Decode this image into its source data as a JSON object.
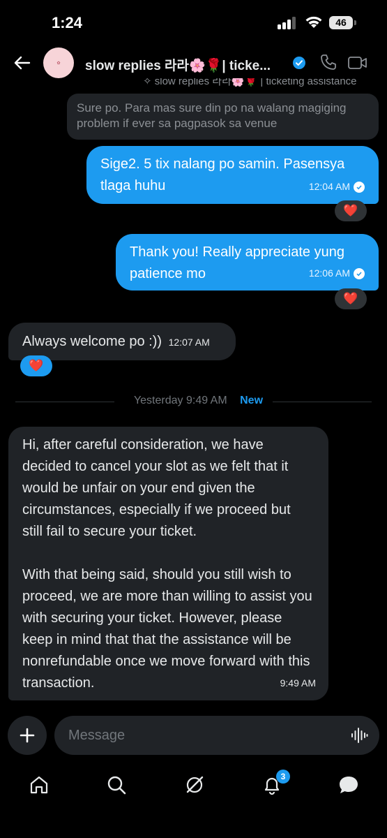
{
  "status_bar": {
    "time": "1:24",
    "battery": "46"
  },
  "header": {
    "title": "slow replies 라라🌸🌹| ticke...",
    "subtitle": "✧ slow replies 라라🌸🌹 | ticketing assistance",
    "verified": true,
    "accent_color": "#1d9bf0"
  },
  "messages": {
    "quoted": {
      "text": "Sure po. Para mas sure din po na walang magiging problem if ever sa pagpasok sa venue"
    },
    "m1": {
      "text": "Sige2. 5 tix nalang po samin. Pasensya tlaga huhu",
      "time": "12:04 AM",
      "reaction": "❤️"
    },
    "m2": {
      "text": "Thank you! Really appreciate yung patience mo",
      "time": "12:06 AM",
      "reaction": "❤️"
    },
    "m3": {
      "text": "Always welcome po :))",
      "time": "12:07 AM",
      "reaction": "❤️"
    },
    "divider": {
      "label": "Yesterday 9:49 AM",
      "new": "New"
    },
    "m4": {
      "text": "Hi, after careful consideration, we have decided to cancel your slot as we felt that it would be unfair on your end given the circumstances, especially if we proceed but still fail to secure your ticket.\n\nWith that being said, should you still wish to proceed, we are more than willing to assist you with securing your ticket. However, please keep in mind that that the assistance will be nonrefundable once we move forward with this transaction.",
      "time": "9:49 AM"
    }
  },
  "composer": {
    "placeholder": "Message"
  },
  "nav": {
    "items": [
      "home-icon",
      "search-icon",
      "grok-icon",
      "notifications-icon",
      "messages-icon"
    ],
    "notification_count": "3"
  },
  "colors": {
    "bubble_sent": "#1d9bf0",
    "bubble_received": "#202327",
    "background": "#000000"
  }
}
